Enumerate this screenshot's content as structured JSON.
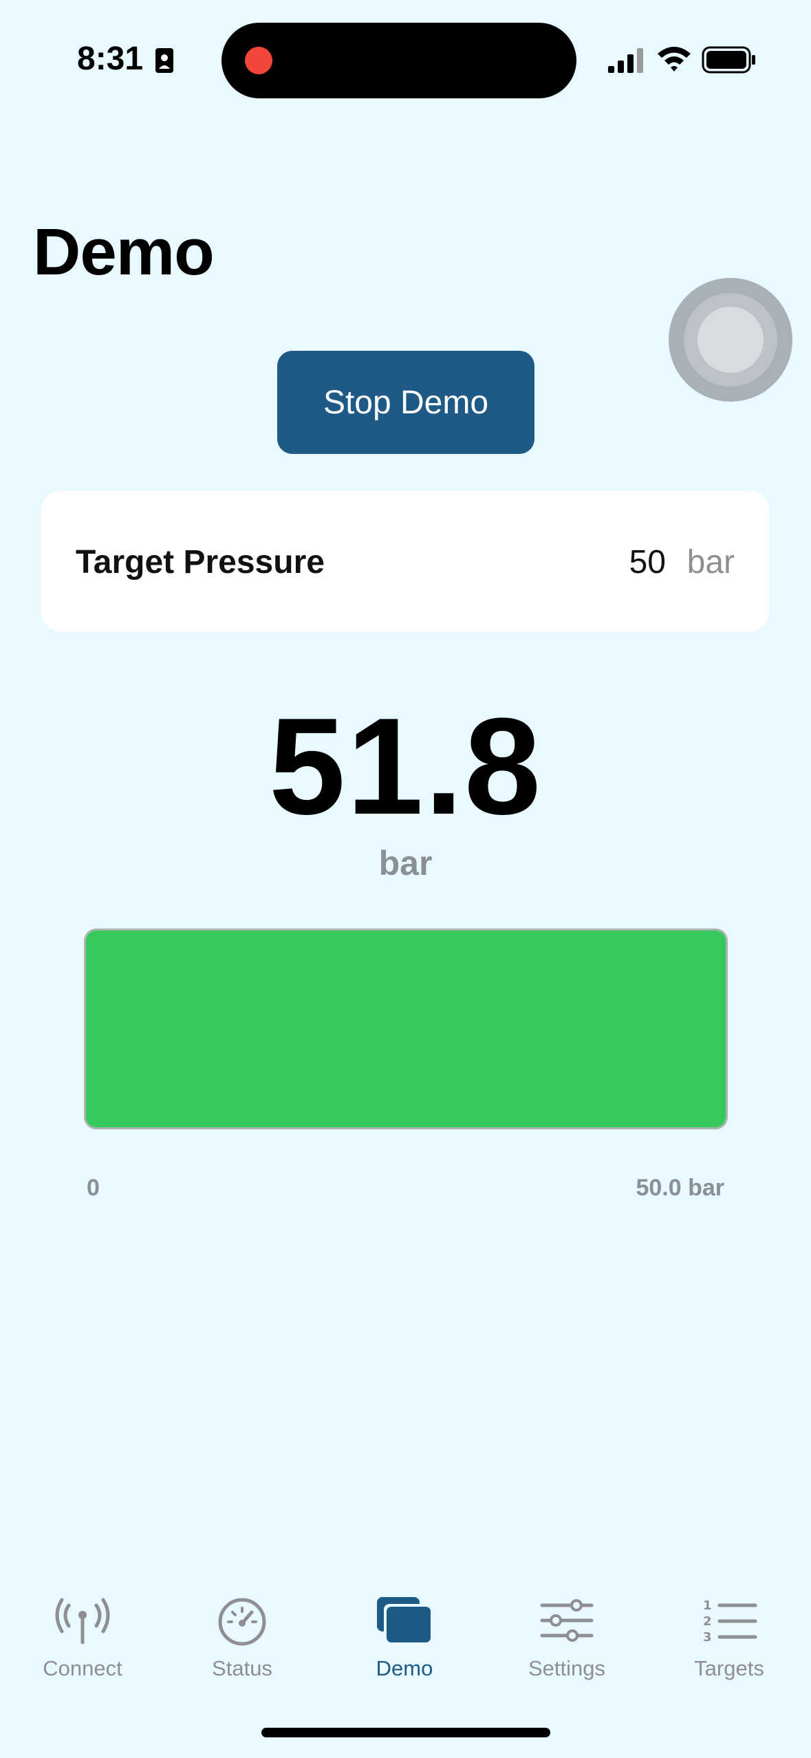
{
  "status_bar": {
    "time": "8:31"
  },
  "page": {
    "title": "Demo"
  },
  "actions": {
    "stop_demo_label": "Stop Demo"
  },
  "target": {
    "label": "Target Pressure",
    "value": "50",
    "unit": "bar"
  },
  "reading": {
    "value": "51.8",
    "unit": "bar"
  },
  "gauge": {
    "min_label": "0",
    "max_label": "50.0 bar",
    "fill_fraction": 1.0,
    "fill_color": "#37c95b"
  },
  "tabs": [
    {
      "label": "Connect",
      "icon": "antenna-icon",
      "active": false
    },
    {
      "label": "Status",
      "icon": "gauge-icon",
      "active": false
    },
    {
      "label": "Demo",
      "icon": "demo-cards-icon",
      "active": true
    },
    {
      "label": "Settings",
      "icon": "sliders-icon",
      "active": false
    },
    {
      "label": "Targets",
      "icon": "numbered-list-icon",
      "active": false
    }
  ],
  "colors": {
    "background": "#e8f9ff",
    "accent": "#1e5a85",
    "inactive": "#8e8e93",
    "recording": "#f2473a"
  }
}
